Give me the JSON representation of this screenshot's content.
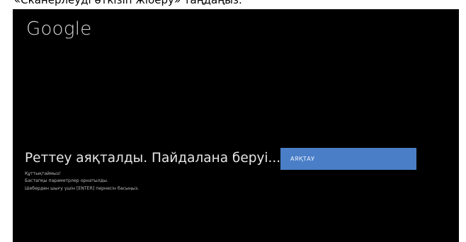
{
  "caption": "«Сканерлеуді өткізіп жіберу» таңдаңыз.",
  "screen": {
    "brand": "Google",
    "headline": "Реттеу аяқталды. Пайдалана беруі...",
    "messages": [
      "Құттықтаймыз!",
      "Бастапқы параметрлер орнатылды.",
      "Шеберден шығу үшін [ENTER] пернесін басыңыз."
    ],
    "finish_button_label": "АЯҚТАУ"
  },
  "colors": {
    "screen_background": "#000000",
    "button_background": "#4a7fc8"
  }
}
